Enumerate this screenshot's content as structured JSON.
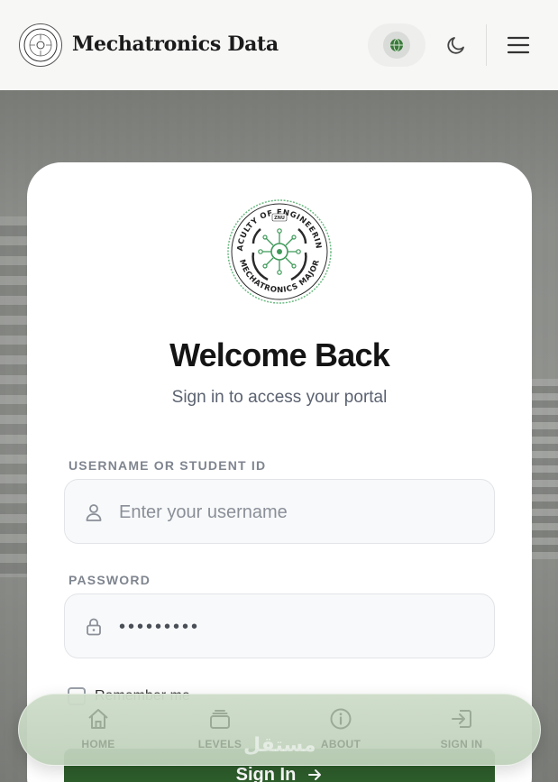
{
  "header": {
    "title": "Mechatronics Data",
    "icons": {
      "logo": "faculty-seal",
      "language": "globe-icon",
      "theme": "moon-icon",
      "menu": "hamburger-icon"
    }
  },
  "card": {
    "logo": {
      "top_arc": "FACULTY OF ENGINEERING",
      "bottom_arc": "MECHATRONICS MAJOR",
      "badge": "ZNU"
    },
    "title": "Welcome Back",
    "subtitle": "Sign in to access your portal",
    "username": {
      "label": "USERNAME OR STUDENT ID",
      "placeholder": "Enter your username",
      "value": "",
      "icon": "user-icon"
    },
    "password": {
      "label": "PASSWORD",
      "value": "•••••••••",
      "icon": "lock-icon"
    },
    "remember_label": "Remember me",
    "signin_label": "Sign In"
  },
  "nav": {
    "items": [
      {
        "label": "HOME",
        "icon": "home-icon"
      },
      {
        "label": "LEVELS",
        "icon": "layers-icon"
      },
      {
        "label": "ABOUT",
        "icon": "info-icon"
      },
      {
        "label": "SIGN IN",
        "icon": "sign-in-icon"
      }
    ]
  },
  "watermark": "مستقل",
  "colors": {
    "accent_green": "#2e5e2c",
    "seal_green": "#3f9a5a",
    "nav_bg": "#c6d8c2"
  }
}
